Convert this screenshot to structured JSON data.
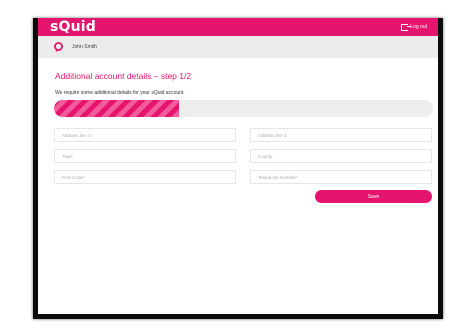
{
  "header": {
    "logo": "sQuid",
    "logout_label": "Log out"
  },
  "user": {
    "name": "John Smith"
  },
  "page": {
    "title": "Additional account details – step 1/2",
    "subtitle": "We require some additional details for your sQuid account."
  },
  "progress": {
    "value": 0.33
  },
  "form": {
    "address1_placeholder": "Address line 1*",
    "address2_placeholder": "Address line 2",
    "town_placeholder": "Town",
    "county_placeholder": "County",
    "postcode_placeholder": "Post Code*",
    "phone_placeholder": "Telephone Number*",
    "save_label": "Save"
  },
  "colors": {
    "brand": "#e5156f",
    "userbar": "#ececec"
  },
  "icons": {
    "logout": "logout-icon",
    "location": "location-pin-icon"
  }
}
